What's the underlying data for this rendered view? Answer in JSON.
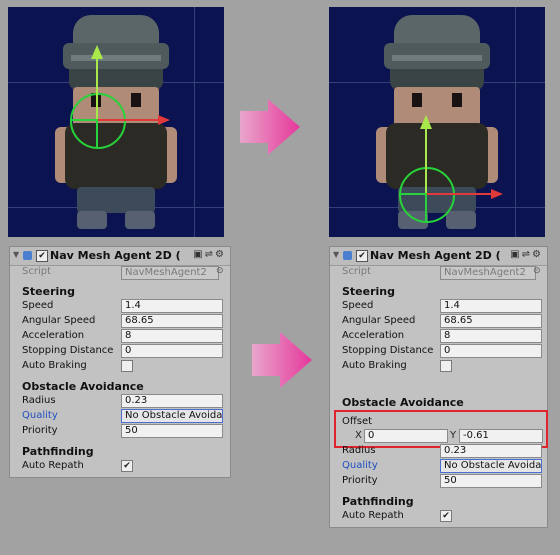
{
  "before": {
    "header": {
      "title": "Nav Mesh Agent 2D ("
    },
    "script": {
      "label": "Script",
      "value": "NavMeshAgent2"
    },
    "steering": {
      "title": "Steering",
      "speed": {
        "label": "Speed",
        "value": "1.4"
      },
      "angular_speed": {
        "label": "Angular Speed",
        "value": "68.65"
      },
      "acceleration": {
        "label": "Acceleration",
        "value": "8"
      },
      "stopping_distance": {
        "label": "Stopping Distance",
        "value": "0"
      },
      "auto_braking": {
        "label": "Auto Braking",
        "checked": false
      }
    },
    "avoidance": {
      "title": "Obstacle Avoidance",
      "radius": {
        "label": "Radius",
        "value": "0.23"
      },
      "quality": {
        "label": "Quality",
        "value": "No Obstacle Avoidant"
      },
      "priority": {
        "label": "Priority",
        "value": "50"
      }
    },
    "pathfinding": {
      "title": "Pathfinding",
      "auto_repath": {
        "label": "Auto Repath",
        "checked": true
      }
    }
  },
  "after": {
    "header": {
      "title": "Nav Mesh Agent 2D ("
    },
    "script": {
      "label": "Script",
      "value": "NavMeshAgent2"
    },
    "steering": {
      "title": "Steering",
      "speed": {
        "label": "Speed",
        "value": "1.4"
      },
      "angular_speed": {
        "label": "Angular Speed",
        "value": "68.65"
      },
      "acceleration": {
        "label": "Acceleration",
        "value": "8"
      },
      "stopping_distance": {
        "label": "Stopping Distance",
        "value": "0"
      },
      "auto_braking": {
        "label": "Auto Braking",
        "checked": false
      }
    },
    "avoidance": {
      "title": "Obstacle Avoidance",
      "offset": {
        "label": "Offset",
        "x_label": "X",
        "x_value": "0",
        "y_label": "Y",
        "y_value": "-0.61"
      },
      "radius": {
        "label": "Radius",
        "value": "0.23"
      },
      "quality": {
        "label": "Quality",
        "value": "No Obstacle Avoidant"
      },
      "priority": {
        "label": "Priority",
        "value": "50"
      }
    },
    "pathfinding": {
      "title": "Pathfinding",
      "auto_repath": {
        "label": "Auto Repath",
        "checked": true
      }
    }
  },
  "colors": {
    "background": "#a2a2a2",
    "scene_bg": "#0b1450",
    "arrow": "#e84aa0",
    "highlight": "#e1232e",
    "gizmo": "#28d23a"
  },
  "icons": [
    "foldout-arrow-icon",
    "component-icon",
    "enabled-checkbox",
    "help-book-icon",
    "preset-icon",
    "gear-icon",
    "object-picker-icon",
    "transition-arrow-icon",
    "move-gizmo-icon"
  ]
}
